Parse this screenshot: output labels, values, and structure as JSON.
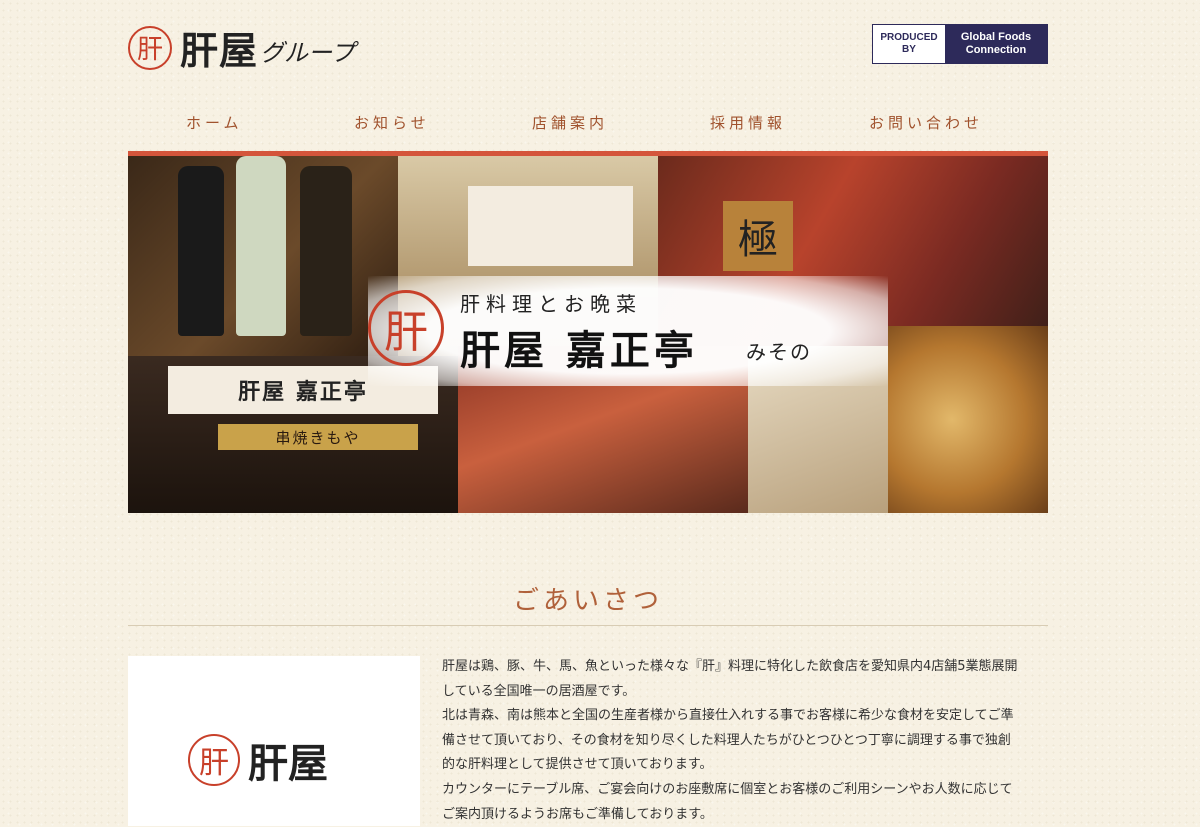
{
  "header": {
    "logo_mark": "肝",
    "logo_title": "肝屋",
    "logo_sub": "グループ",
    "produced_left": "PRODUCED BY",
    "produced_right_line1": "Global Foods",
    "produced_right_line2": "Connection"
  },
  "nav": {
    "items": [
      {
        "label": "ホーム"
      },
      {
        "label": "お知らせ"
      },
      {
        "label": "店舗案内"
      },
      {
        "label": "採用情報"
      },
      {
        "label": "お問い合わせ"
      }
    ]
  },
  "hero": {
    "banner_mark": "肝",
    "banner_sub": "肝料理とお晩菜",
    "banner_main": "肝屋 嘉正亭",
    "banner_small": "みその",
    "sign_tile": "極",
    "store_sign": "肝屋 嘉正亭",
    "store_sign2": "串焼きもや"
  },
  "greeting": {
    "title": "ごあいさつ",
    "logo_mark": "肝",
    "logo_text": "肝屋",
    "lines": [
      "肝屋は鶏、豚、牛、馬、魚といった様々な『肝』料理に特化した飲食店を愛知県内4店舗5業態展開",
      "している全国唯一の居酒屋です。",
      "北は青森、南は熊本と全国の生産者様から直接仕入れする事でお客様に希少な食材を安定してご準",
      "備させて頂いており、その食材を知り尽くした料理人たちがひとつひとつ丁寧に調理する事で独創",
      "的な肝料理として提供させて頂いております。",
      "カウンターにテーブル席、ご宴会向けのお座敷席に個室とお客様のご利用シーンやお人数に応じて",
      "ご案内頂けるようお席もご準備しております。"
    ]
  },
  "colors": {
    "accent": "#d4553b",
    "nav_text": "#a0522d",
    "title_text": "#b0613a",
    "badge_navy": "#2d2a5a"
  }
}
